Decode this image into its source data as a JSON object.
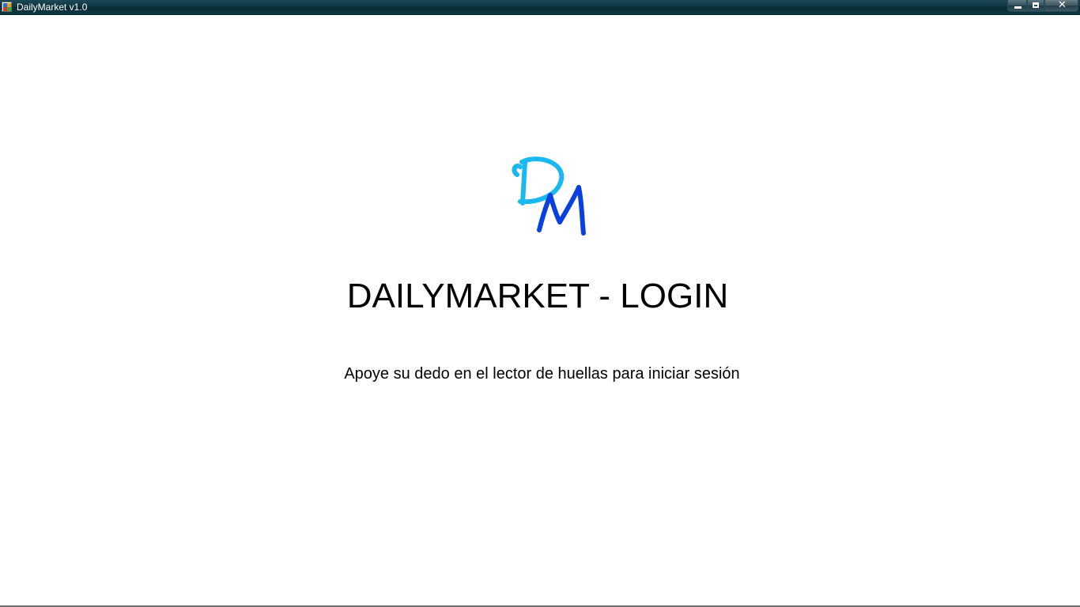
{
  "window": {
    "title": "DailyMarket v1.0",
    "icon": "application-icon",
    "controls": {
      "minimize": "minimize-icon",
      "maximize": "maximize-icon",
      "close_label": "✕"
    }
  },
  "login": {
    "logo_letters": [
      "D",
      "M"
    ],
    "logo_colors": {
      "d": "#19b9f0",
      "m": "#0a3fe0"
    },
    "heading": "DAILYMARKET - LOGIN",
    "instruction": "Apoye su dedo en el lector de huellas para iniciar sesión"
  }
}
